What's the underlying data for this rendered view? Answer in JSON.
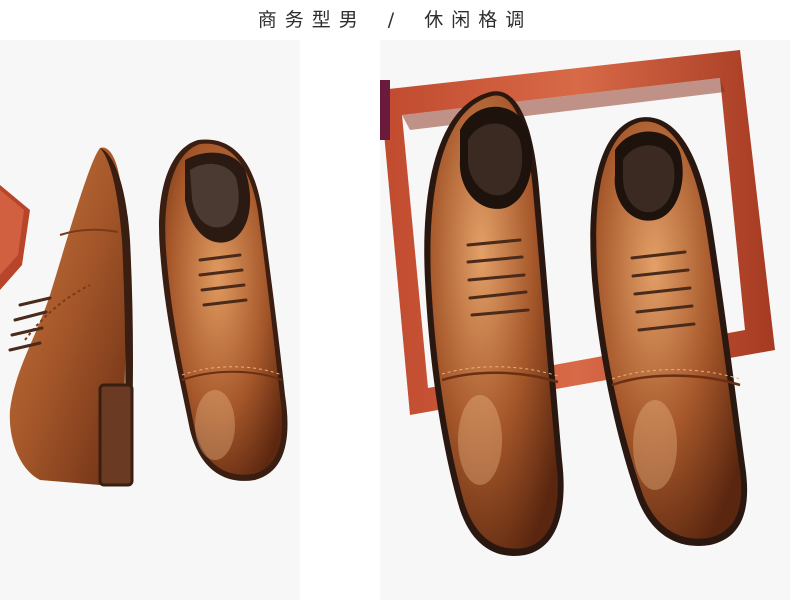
{
  "header": {
    "left_text": "商务型男",
    "separator": "/",
    "right_text": "休闲格调"
  },
  "colors": {
    "leather": "#a5572a",
    "leather_dark": "#6b2f14",
    "leather_light": "#d08a55",
    "frame_wood": "#b8442a",
    "sole": "#3a1e12",
    "background": "#ffffff"
  }
}
